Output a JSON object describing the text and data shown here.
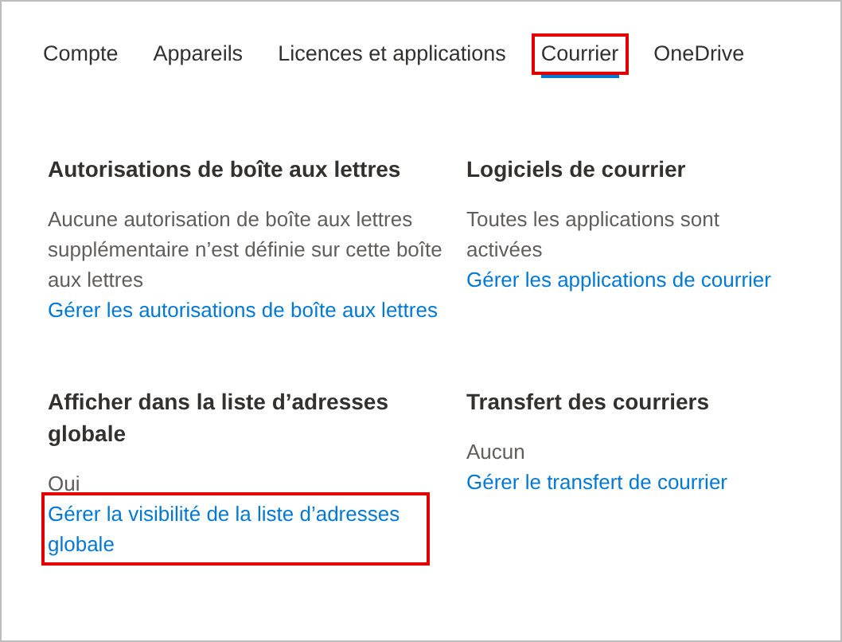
{
  "tabs": [
    {
      "label": "Compte",
      "selected": false,
      "highlighted": false
    },
    {
      "label": "Appareils",
      "selected": false,
      "highlighted": false
    },
    {
      "label": "Licences et applications",
      "selected": false,
      "highlighted": false
    },
    {
      "label": "Courrier",
      "selected": true,
      "highlighted": true
    },
    {
      "label": "OneDrive",
      "selected": false,
      "highlighted": false
    }
  ],
  "sections": [
    {
      "title": "Autorisations de boîte aux lettres",
      "text": "Aucune autorisation de boîte aux lettres supplémentaire n’est définie sur cette boîte aux lettres",
      "link": "Gérer les autorisations de boîte aux lettres",
      "highlighted": false
    },
    {
      "title": "Logiciels de courrier",
      "text": "Toutes les applications sont activées",
      "link": "Gérer les applications de courrier",
      "highlighted": false
    },
    {
      "title": "Afficher dans la liste d’adresses globale",
      "text": "Oui",
      "link": "Gérer la visibilité de la liste d’adresses globale",
      "highlighted": true
    },
    {
      "title": "Transfert des courriers",
      "text": "Aucun",
      "link": "Gérer le transfert de courrier",
      "highlighted": false
    }
  ]
}
